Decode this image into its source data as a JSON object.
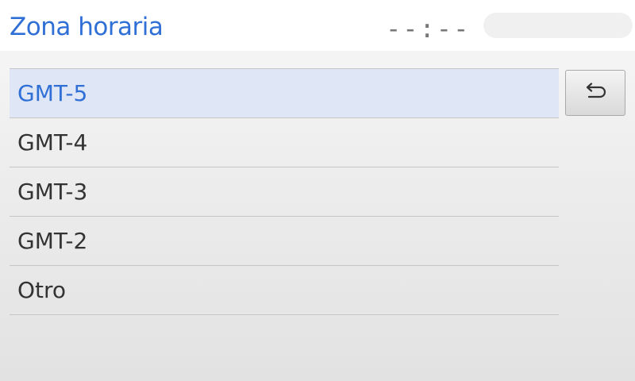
{
  "header": {
    "title": "Zona horaria",
    "clock": "--:--"
  },
  "list": {
    "items": [
      {
        "label": "GMT-5",
        "selected": true
      },
      {
        "label": "GMT-4",
        "selected": false
      },
      {
        "label": "GMT-3",
        "selected": false
      },
      {
        "label": "GMT-2",
        "selected": false
      },
      {
        "label": "Otro",
        "selected": false
      }
    ]
  },
  "buttons": {
    "back_icon": "back-arrow-icon"
  },
  "colors": {
    "accent": "#2f6fd6",
    "selected_row": "#dfe6f5"
  }
}
